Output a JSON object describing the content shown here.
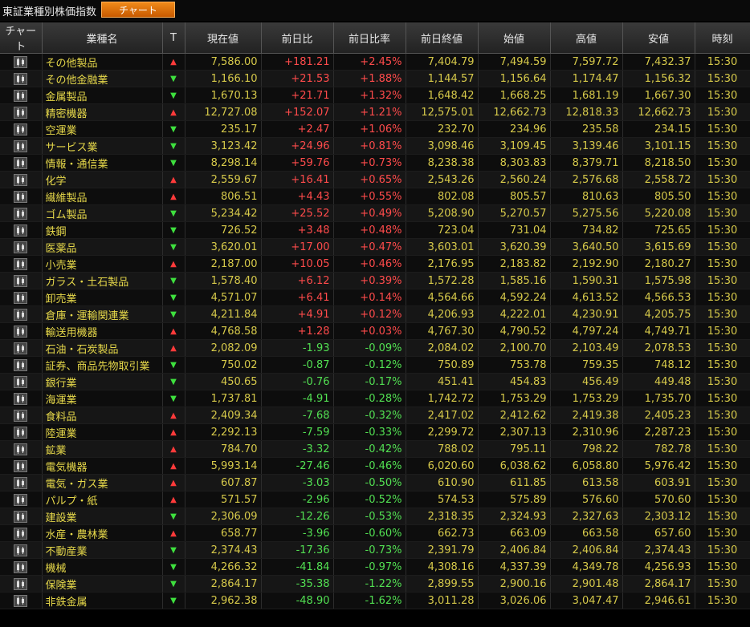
{
  "header": {
    "title": "東証業種別株価指数",
    "chart_button": "チャート"
  },
  "columns": [
    "チャート",
    "業種名",
    "T",
    "現在値",
    "前日比",
    "前日比率",
    "前日終値",
    "始値",
    "高値",
    "安値",
    "時刻"
  ],
  "rows": [
    {
      "name": "その他製品",
      "t": "up",
      "price": "7,586.00",
      "chg": "+181.21",
      "pct": "+2.45%",
      "prev": "7,404.79",
      "open": "7,494.59",
      "high": "7,597.72",
      "low": "7,432.37",
      "time": "15:30"
    },
    {
      "name": "その他金融業",
      "t": "down",
      "price": "1,166.10",
      "chg": "+21.53",
      "pct": "+1.88%",
      "prev": "1,144.57",
      "open": "1,156.64",
      "high": "1,174.47",
      "low": "1,156.32",
      "time": "15:30"
    },
    {
      "name": "金属製品",
      "t": "down",
      "price": "1,670.13",
      "chg": "+21.71",
      "pct": "+1.32%",
      "prev": "1,648.42",
      "open": "1,668.25",
      "high": "1,681.19",
      "low": "1,667.30",
      "time": "15:30"
    },
    {
      "name": "精密機器",
      "t": "up",
      "price": "12,727.08",
      "chg": "+152.07",
      "pct": "+1.21%",
      "prev": "12,575.01",
      "open": "12,662.73",
      "high": "12,818.33",
      "low": "12,662.73",
      "time": "15:30"
    },
    {
      "name": "空運業",
      "t": "down",
      "price": "235.17",
      "chg": "+2.47",
      "pct": "+1.06%",
      "prev": "232.70",
      "open": "234.96",
      "high": "235.58",
      "low": "234.15",
      "time": "15:30"
    },
    {
      "name": "サービス業",
      "t": "down",
      "price": "3,123.42",
      "chg": "+24.96",
      "pct": "+0.81%",
      "prev": "3,098.46",
      "open": "3,109.45",
      "high": "3,139.46",
      "low": "3,101.15",
      "time": "15:30"
    },
    {
      "name": "情報・通信業",
      "t": "down",
      "price": "8,298.14",
      "chg": "+59.76",
      "pct": "+0.73%",
      "prev": "8,238.38",
      "open": "8,303.83",
      "high": "8,379.71",
      "low": "8,218.50",
      "time": "15:30"
    },
    {
      "name": "化学",
      "t": "up",
      "price": "2,559.67",
      "chg": "+16.41",
      "pct": "+0.65%",
      "prev": "2,543.26",
      "open": "2,560.24",
      "high": "2,576.68",
      "low": "2,558.72",
      "time": "15:30"
    },
    {
      "name": "繊維製品",
      "t": "up",
      "price": "806.51",
      "chg": "+4.43",
      "pct": "+0.55%",
      "prev": "802.08",
      "open": "805.57",
      "high": "810.63",
      "low": "805.50",
      "time": "15:30"
    },
    {
      "name": "ゴム製品",
      "t": "down",
      "price": "5,234.42",
      "chg": "+25.52",
      "pct": "+0.49%",
      "prev": "5,208.90",
      "open": "5,270.57",
      "high": "5,275.56",
      "low": "5,220.08",
      "time": "15:30"
    },
    {
      "name": "鉄鋼",
      "t": "down",
      "price": "726.52",
      "chg": "+3.48",
      "pct": "+0.48%",
      "prev": "723.04",
      "open": "731.04",
      "high": "734.82",
      "low": "725.65",
      "time": "15:30"
    },
    {
      "name": "医薬品",
      "t": "down",
      "price": "3,620.01",
      "chg": "+17.00",
      "pct": "+0.47%",
      "prev": "3,603.01",
      "open": "3,620.39",
      "high": "3,640.50",
      "low": "3,615.69",
      "time": "15:30"
    },
    {
      "name": "小売業",
      "t": "up",
      "price": "2,187.00",
      "chg": "+10.05",
      "pct": "+0.46%",
      "prev": "2,176.95",
      "open": "2,183.82",
      "high": "2,192.90",
      "low": "2,180.27",
      "time": "15:30"
    },
    {
      "name": "ガラス・土石製品",
      "t": "down",
      "price": "1,578.40",
      "chg": "+6.12",
      "pct": "+0.39%",
      "prev": "1,572.28",
      "open": "1,585.16",
      "high": "1,590.31",
      "low": "1,575.98",
      "time": "15:30"
    },
    {
      "name": "卸売業",
      "t": "down",
      "price": "4,571.07",
      "chg": "+6.41",
      "pct": "+0.14%",
      "prev": "4,564.66",
      "open": "4,592.24",
      "high": "4,613.52",
      "low": "4,566.53",
      "time": "15:30"
    },
    {
      "name": "倉庫・運輸関連業",
      "t": "down",
      "price": "4,211.84",
      "chg": "+4.91",
      "pct": "+0.12%",
      "prev": "4,206.93",
      "open": "4,222.01",
      "high": "4,230.91",
      "low": "4,205.75",
      "time": "15:30"
    },
    {
      "name": "輸送用機器",
      "t": "up",
      "price": "4,768.58",
      "chg": "+1.28",
      "pct": "+0.03%",
      "prev": "4,767.30",
      "open": "4,790.52",
      "high": "4,797.24",
      "low": "4,749.71",
      "time": "15:30"
    },
    {
      "name": "石油・石炭製品",
      "t": "up",
      "price": "2,082.09",
      "chg": "-1.93",
      "pct": "-0.09%",
      "prev": "2,084.02",
      "open": "2,100.70",
      "high": "2,103.49",
      "low": "2,078.53",
      "time": "15:30"
    },
    {
      "name": "証券、商品先物取引業",
      "t": "down",
      "price": "750.02",
      "chg": "-0.87",
      "pct": "-0.12%",
      "prev": "750.89",
      "open": "753.78",
      "high": "759.35",
      "low": "748.12",
      "time": "15:30"
    },
    {
      "name": "銀行業",
      "t": "down",
      "price": "450.65",
      "chg": "-0.76",
      "pct": "-0.17%",
      "prev": "451.41",
      "open": "454.83",
      "high": "456.49",
      "low": "449.48",
      "time": "15:30"
    },
    {
      "name": "海運業",
      "t": "down",
      "price": "1,737.81",
      "chg": "-4.91",
      "pct": "-0.28%",
      "prev": "1,742.72",
      "open": "1,753.29",
      "high": "1,753.29",
      "low": "1,735.70",
      "time": "15:30"
    },
    {
      "name": "食料品",
      "t": "up",
      "price": "2,409.34",
      "chg": "-7.68",
      "pct": "-0.32%",
      "prev": "2,417.02",
      "open": "2,412.62",
      "high": "2,419.38",
      "low": "2,405.23",
      "time": "15:30"
    },
    {
      "name": "陸運業",
      "t": "up",
      "price": "2,292.13",
      "chg": "-7.59",
      "pct": "-0.33%",
      "prev": "2,299.72",
      "open": "2,307.13",
      "high": "2,310.96",
      "low": "2,287.23",
      "time": "15:30"
    },
    {
      "name": "鉱業",
      "t": "up",
      "price": "784.70",
      "chg": "-3.32",
      "pct": "-0.42%",
      "prev": "788.02",
      "open": "795.11",
      "high": "798.22",
      "low": "782.78",
      "time": "15:30"
    },
    {
      "name": "電気機器",
      "t": "up",
      "price": "5,993.14",
      "chg": "-27.46",
      "pct": "-0.46%",
      "prev": "6,020.60",
      "open": "6,038.62",
      "high": "6,058.80",
      "low": "5,976.42",
      "time": "15:30"
    },
    {
      "name": "電気・ガス業",
      "t": "up",
      "price": "607.87",
      "chg": "-3.03",
      "pct": "-0.50%",
      "prev": "610.90",
      "open": "611.85",
      "high": "613.58",
      "low": "603.91",
      "time": "15:30"
    },
    {
      "name": "パルプ・紙",
      "t": "up",
      "price": "571.57",
      "chg": "-2.96",
      "pct": "-0.52%",
      "prev": "574.53",
      "open": "575.89",
      "high": "576.60",
      "low": "570.60",
      "time": "15:30"
    },
    {
      "name": "建設業",
      "t": "down",
      "price": "2,306.09",
      "chg": "-12.26",
      "pct": "-0.53%",
      "prev": "2,318.35",
      "open": "2,324.93",
      "high": "2,327.63",
      "low": "2,303.12",
      "time": "15:30"
    },
    {
      "name": "水産・農林業",
      "t": "up",
      "price": "658.77",
      "chg": "-3.96",
      "pct": "-0.60%",
      "prev": "662.73",
      "open": "663.09",
      "high": "663.58",
      "low": "657.60",
      "time": "15:30"
    },
    {
      "name": "不動産業",
      "t": "down",
      "price": "2,374.43",
      "chg": "-17.36",
      "pct": "-0.73%",
      "prev": "2,391.79",
      "open": "2,406.84",
      "high": "2,406.84",
      "low": "2,374.43",
      "time": "15:30"
    },
    {
      "name": "機械",
      "t": "down",
      "price": "4,266.32",
      "chg": "-41.84",
      "pct": "-0.97%",
      "prev": "4,308.16",
      "open": "4,337.39",
      "high": "4,349.78",
      "low": "4,256.93",
      "time": "15:30"
    },
    {
      "name": "保険業",
      "t": "down",
      "price": "2,864.17",
      "chg": "-35.38",
      "pct": "-1.22%",
      "prev": "2,899.55",
      "open": "2,900.16",
      "high": "2,901.48",
      "low": "2,864.17",
      "time": "15:30"
    },
    {
      "name": "非鉄金属",
      "t": "down",
      "price": "2,962.38",
      "chg": "-48.90",
      "pct": "-1.62%",
      "prev": "3,011.28",
      "open": "3,026.06",
      "high": "3,047.47",
      "low": "2,946.61",
      "time": "15:30"
    }
  ],
  "trend_symbols": {
    "up": "▲",
    "down": "▼"
  },
  "colors": {
    "accent_orange": "#e07010",
    "positive": "#ff4b4b",
    "negative": "#52e052",
    "name_text": "#e6d84a",
    "value_text": "#d6c94a"
  }
}
